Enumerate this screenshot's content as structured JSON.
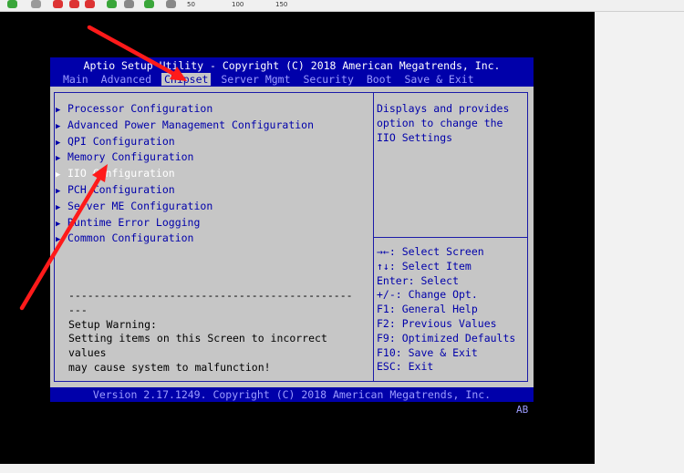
{
  "toolbar": {
    "ruler_labels": [
      "50",
      "100",
      "150"
    ]
  },
  "bios": {
    "title": "Aptio Setup Utility - Copyright (C) 2018 American Megatrends, Inc.",
    "tabs": [
      "Main",
      "Advanced",
      "Chipset",
      "Server Mgmt",
      "Security",
      "Boot",
      "Save & Exit"
    ],
    "active_tab": "Chipset",
    "menu_items": [
      "Processor Configuration",
      "Advanced Power Management Configuration",
      "QPI Configuration",
      "Memory Configuration",
      "IIO Configuration",
      "PCH Configuration",
      "Server ME Configuration",
      "Runtime Error Logging",
      "Common Configuration"
    ],
    "selected_item": "IIO Configuration",
    "help_lines": [
      "Displays and provides",
      "option to change the",
      "IIO Settings"
    ],
    "key_help": [
      "→←: Select Screen",
      "↑↓: Select Item",
      "Enter: Select",
      "+/-: Change Opt.",
      "F1: General Help",
      "F2: Previous Values",
      "F9: Optimized Defaults",
      "F10: Save & Exit",
      "ESC: Exit"
    ],
    "warning_lines": [
      "---------------------------------------------",
      "---",
      "Setup Warning:",
      "Setting items on this Screen to incorrect",
      "values",
      "may cause system to malfunction!"
    ],
    "footer": "Version 2.17.1249. Copyright (C) 2018 American Megatrends, Inc.",
    "corner_label": "AB"
  },
  "colors": {
    "bios_blue": "#0000aa",
    "bios_gray": "#c6c6c6",
    "tab_text": "#9c9cff",
    "annotation_red": "#ff1a1a"
  }
}
